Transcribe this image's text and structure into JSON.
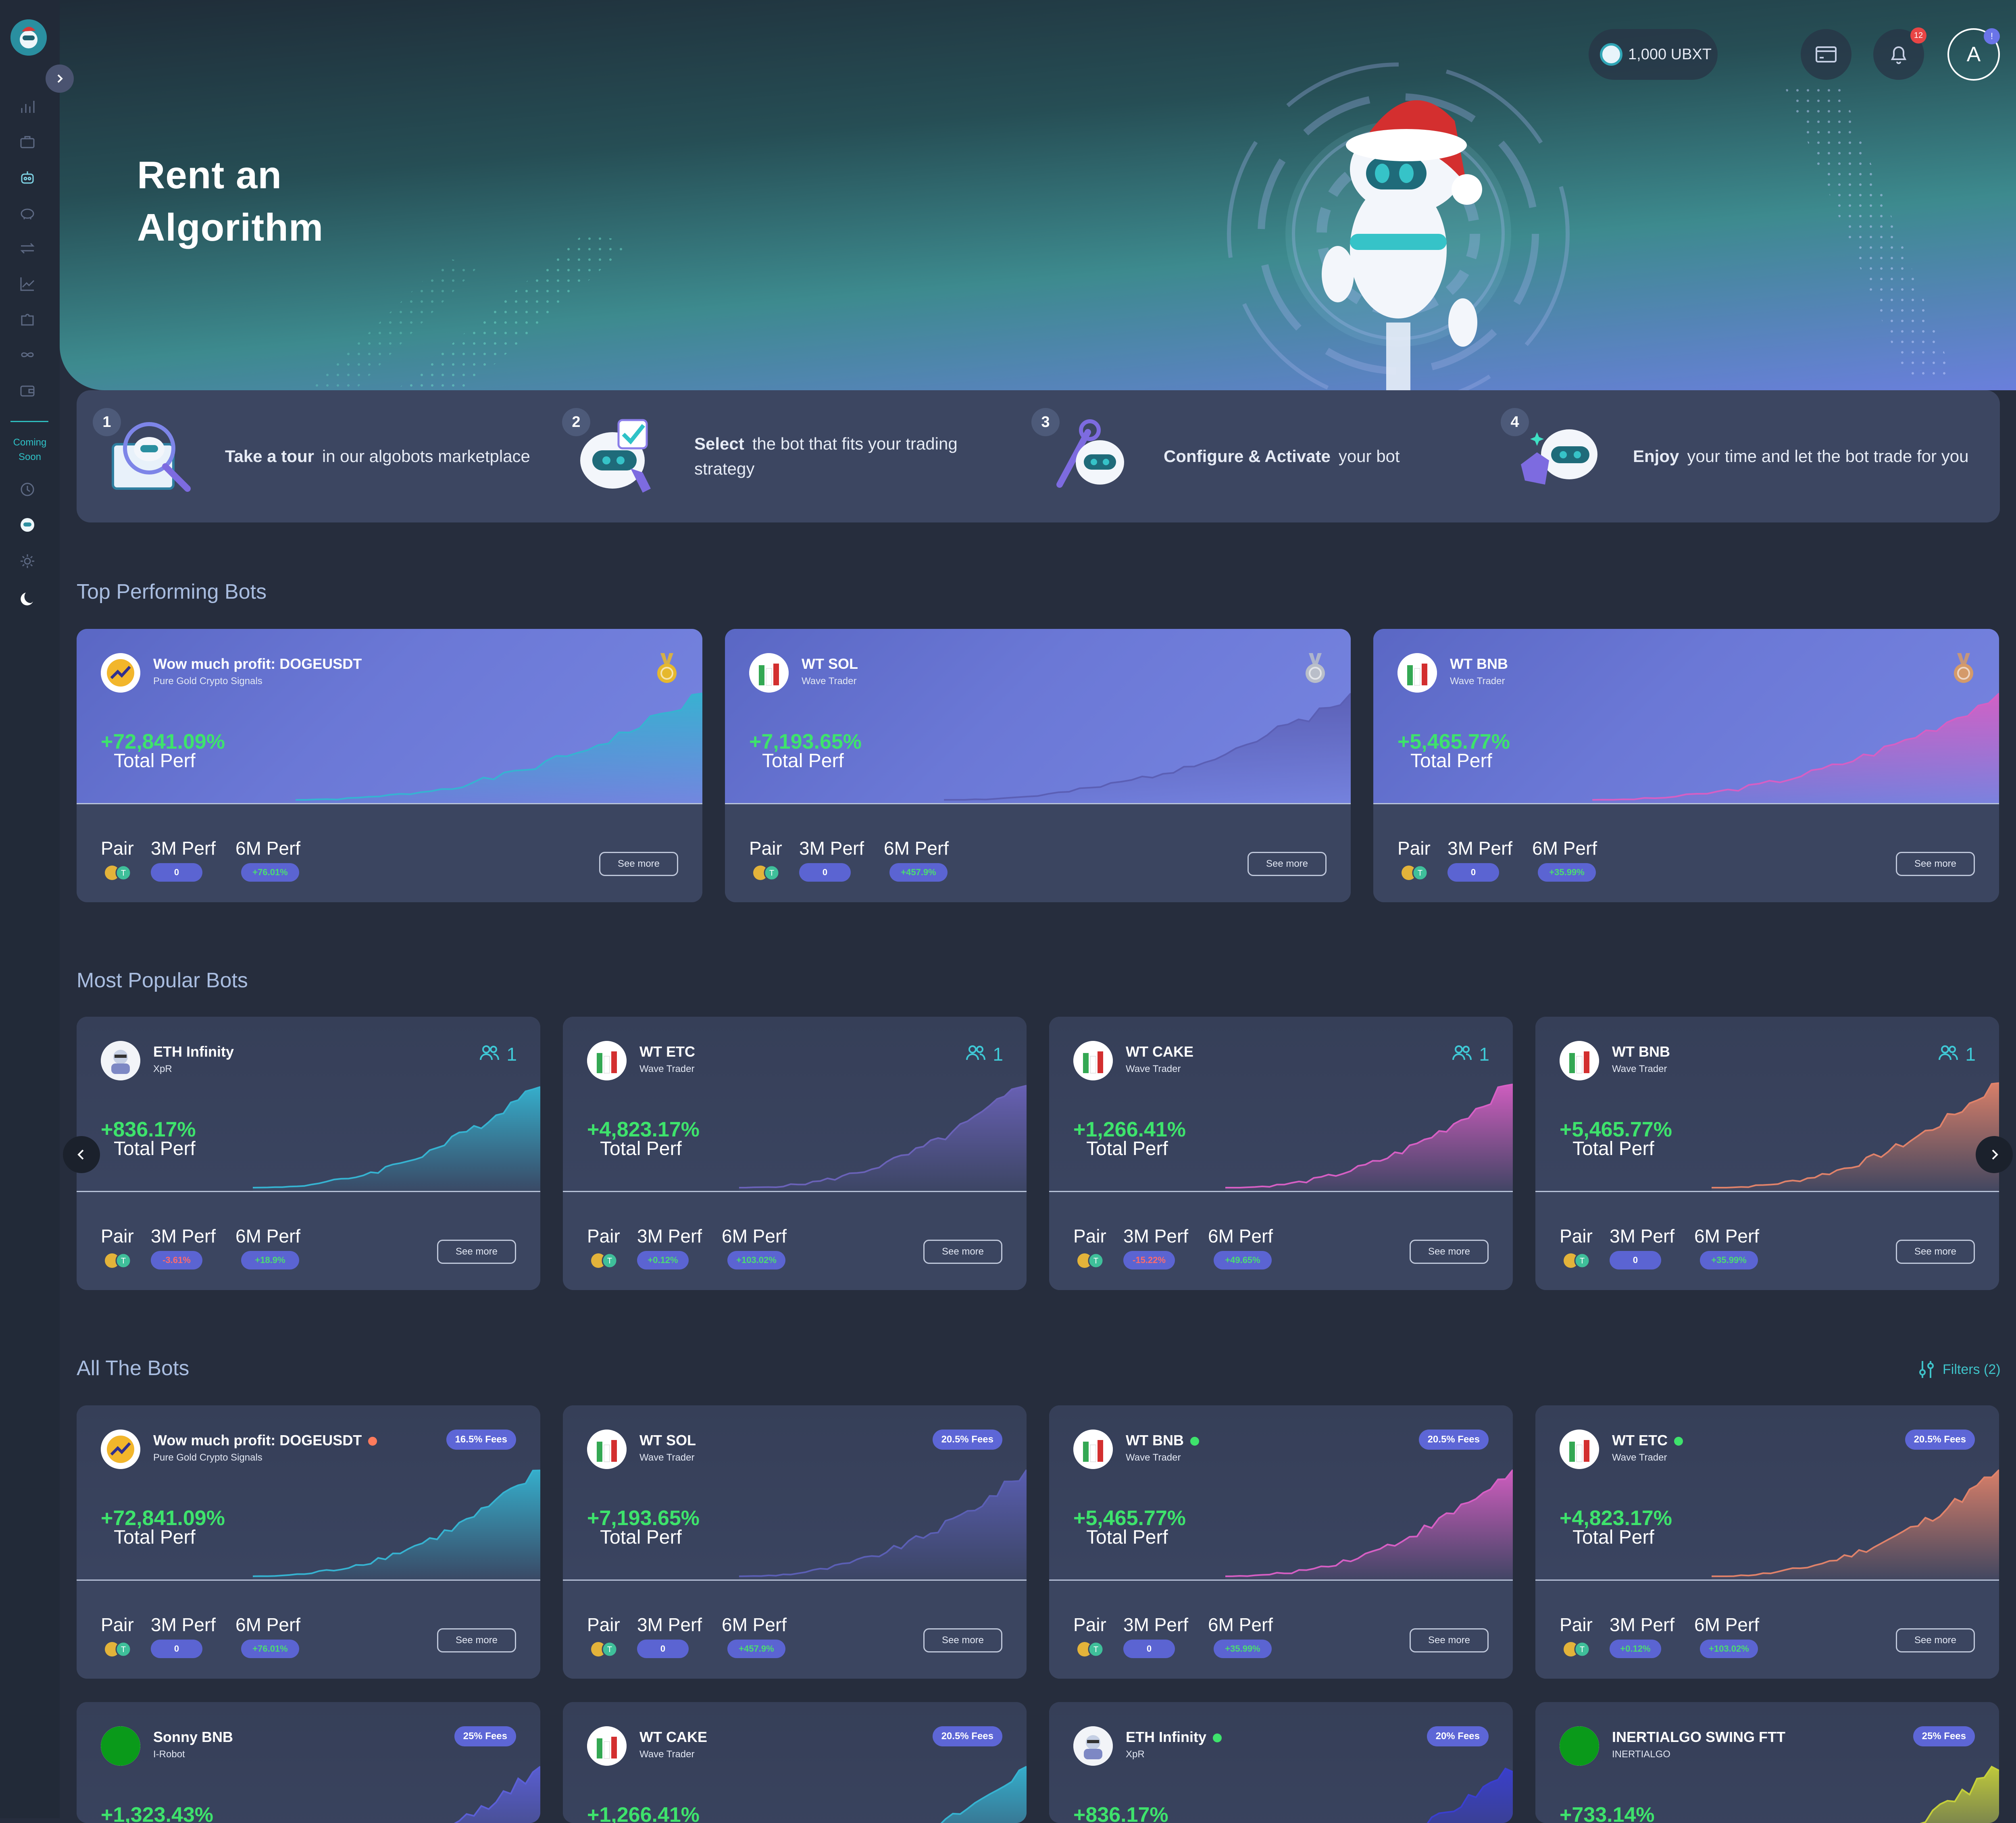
{
  "sidebar": {
    "coming_soon": "Coming Soon",
    "icons": [
      "bar-chart-icon",
      "briefcase-icon",
      "bot-icon",
      "piggy-bank-icon",
      "transfer-icon",
      "line-chart-icon",
      "puzzle-icon",
      "infinity-icon",
      "wallet-icon"
    ],
    "bottom_icons": [
      "clock-icon",
      "robot-icon",
      "sun-icon",
      "moon-icon"
    ]
  },
  "header": {
    "title_line1": "Rent an",
    "title_line2": "Algorithm",
    "balance": "1,000 UBXT",
    "notifications_count": "12",
    "avatar_letter": "A",
    "avatar_badge": "!"
  },
  "steps": [
    {
      "num": "1",
      "bold": "Take a tour",
      "text": "in our algobots marketplace"
    },
    {
      "num": "2",
      "bold": "Select",
      "text": "the bot that fits your trading strategy"
    },
    {
      "num": "3",
      "bold": "Configure & Activate",
      "text": "your bot"
    },
    {
      "num": "4",
      "bold": "Enjoy",
      "text": "your time and let the bot trade for you"
    }
  ],
  "sections": {
    "top": "Top Performing Bots",
    "popular": "Most Popular Bots",
    "all": "All The Bots",
    "filters": "Filters (2)"
  },
  "labels": {
    "total_perf": "Total Perf",
    "pair": "Pair",
    "perf_3m": "3M Perf",
    "perf_6m": "6M Perf",
    "see_more": "See more"
  },
  "colors": {
    "accent_teal": "#3fc3c9",
    "positive": "#3ee36c",
    "negative": "#ff6b6b",
    "pill_bg": "#5b64d2",
    "card_bg": "#3d4762"
  },
  "top_bots": [
    {
      "name": "Wow much profit: DOGEUSDT",
      "sub": "Pure Gold Crypto Signals",
      "perf": "+72,841.09%",
      "m3": "0",
      "m6": "+76.01%",
      "medal": "gold",
      "logo": "doge",
      "color": "#36b3d1"
    },
    {
      "name": "WT SOL",
      "sub": "Wave Trader",
      "perf": "+7,193.65%",
      "m3": "0",
      "m6": "+457.9%",
      "medal": "silver",
      "logo": "wt",
      "color": "#5b5fb5"
    },
    {
      "name": "WT BNB",
      "sub": "Wave Trader",
      "perf": "+5,465.77%",
      "m3": "0",
      "m6": "+35.99%",
      "medal": "bronze",
      "logo": "wt",
      "color": "#d65fc4"
    }
  ],
  "popular_bots": [
    {
      "name": "ETH Infinity",
      "sub": "XpR",
      "perf": "+836.17%",
      "m3": "-3.61%",
      "m6": "+18.9%",
      "users": "1",
      "logo": "xpr",
      "color": "#36b3d1"
    },
    {
      "name": "WT ETC",
      "sub": "Wave Trader",
      "perf": "+4,823.17%",
      "m3": "+0.12%",
      "m6": "+103.02%",
      "users": "1",
      "logo": "wt",
      "color": "#6a62b8"
    },
    {
      "name": "WT CAKE",
      "sub": "Wave Trader",
      "perf": "+1,266.41%",
      "m3": "-15.22%",
      "m6": "+49.65%",
      "users": "1",
      "logo": "wt",
      "color": "#d65fc4"
    },
    {
      "name": "WT BNB",
      "sub": "Wave Trader",
      "perf": "+5,465.77%",
      "m3": "0",
      "m6": "+35.99%",
      "users": "1",
      "logo": "wt",
      "color": "#e0826a"
    }
  ],
  "all_bots": [
    {
      "name": "Wow much profit: DOGEUSDT",
      "sub": "Pure Gold Crypto Signals",
      "perf": "+72,841.09%",
      "m3": "0",
      "m6": "+76.01%",
      "fees": "16.5% Fees",
      "status": "#ff7b5c",
      "logo": "doge",
      "color": "#36b3d1"
    },
    {
      "name": "WT SOL",
      "sub": "Wave Trader",
      "perf": "+7,193.65%",
      "m3": "0",
      "m6": "+457.9%",
      "fees": "20.5% Fees",
      "status": "",
      "logo": "wt",
      "color": "#5b5fb5"
    },
    {
      "name": "WT BNB",
      "sub": "Wave Trader",
      "perf": "+5,465.77%",
      "m3": "0",
      "m6": "+35.99%",
      "fees": "20.5% Fees",
      "status": "#3ee36c",
      "logo": "wt",
      "color": "#d65fc4"
    },
    {
      "name": "WT ETC",
      "sub": "Wave Trader",
      "perf": "+4,823.17%",
      "m3": "+0.12%",
      "m6": "+103.02%",
      "fees": "20.5% Fees",
      "status": "#3ee36c",
      "logo": "wt",
      "color": "#e0826a"
    },
    {
      "name": "Sonny BNB",
      "sub": "I-Robot",
      "perf": "+1,323.43%",
      "fees": "25% Fees",
      "status": "",
      "logo": "green",
      "color": "#5b5fd6"
    },
    {
      "name": "WT CAKE",
      "sub": "Wave Trader",
      "perf": "+1,266.41%",
      "fees": "20.5% Fees",
      "status": "",
      "logo": "wt",
      "color": "#36b3d1"
    },
    {
      "name": "ETH Infinity",
      "sub": "XpR",
      "perf": "+836.17%",
      "fees": "20% Fees",
      "status": "#3ee36c",
      "logo": "xpr",
      "color": "#3a3fd0"
    },
    {
      "name": "INERTIALGO SWING FTT",
      "sub": "INERTIALGO",
      "perf": "+733.14%",
      "fees": "25% Fees",
      "status": "",
      "logo": "green",
      "color": "#c6d03a"
    }
  ]
}
